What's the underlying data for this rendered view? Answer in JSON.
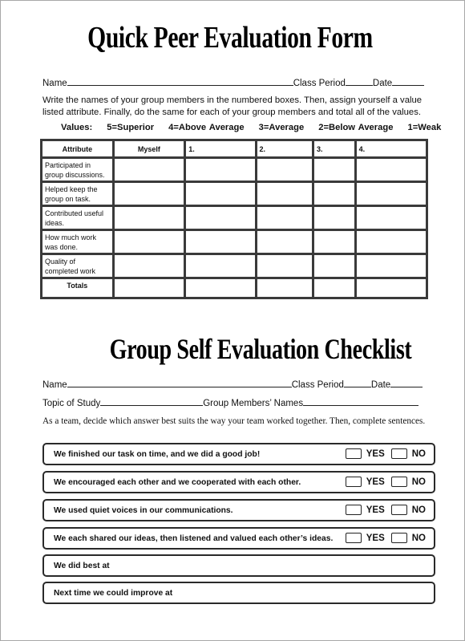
{
  "peer_form": {
    "title": "Quick Peer Evaluation Form",
    "name_label": "Name",
    "class_period_label": "Class Period",
    "date_label": "Date",
    "instructions": "Write the names of your group members in the numbered boxes.  Then,  assign yourself a value listed attribute.  Finally, do the same for each of your group members and total all of the values.",
    "values_label": "Values:",
    "values": [
      "5=Superior",
      "4=Above Average",
      "3=Average",
      "2=Below Average",
      "1=Weak"
    ],
    "table": {
      "headers": [
        "Attribute",
        "Myself",
        "1.",
        "2.",
        "3.",
        "4."
      ],
      "rows": [
        "Participated in group discussions.",
        "Helped keep the group on task.",
        "Contributed useful ideas.",
        "How much work was done.",
        "Quality of completed work"
      ],
      "totals_label": "Totals"
    }
  },
  "checklist": {
    "title": "Group Self Evaluation Checklist",
    "name_label": "Name",
    "class_period_label": "Class Period",
    "date_label": "Date",
    "topic_label": "Topic of Study",
    "members_label": "Group Members’ Names",
    "instructions": "As a team, decide which answer best suits the way your team worked together.  Then, complete sentences.",
    "yes_label": "YES",
    "no_label": "NO",
    "statements": [
      "We finished our task on time, and we did a good job!",
      "We encouraged each other and we cooperated with each other.",
      "We used quiet voices in our communications.",
      "We each shared our ideas, then listened and valued each other’s ideas."
    ],
    "prompts": [
      "We did best at",
      "Next time we could improve at"
    ]
  }
}
